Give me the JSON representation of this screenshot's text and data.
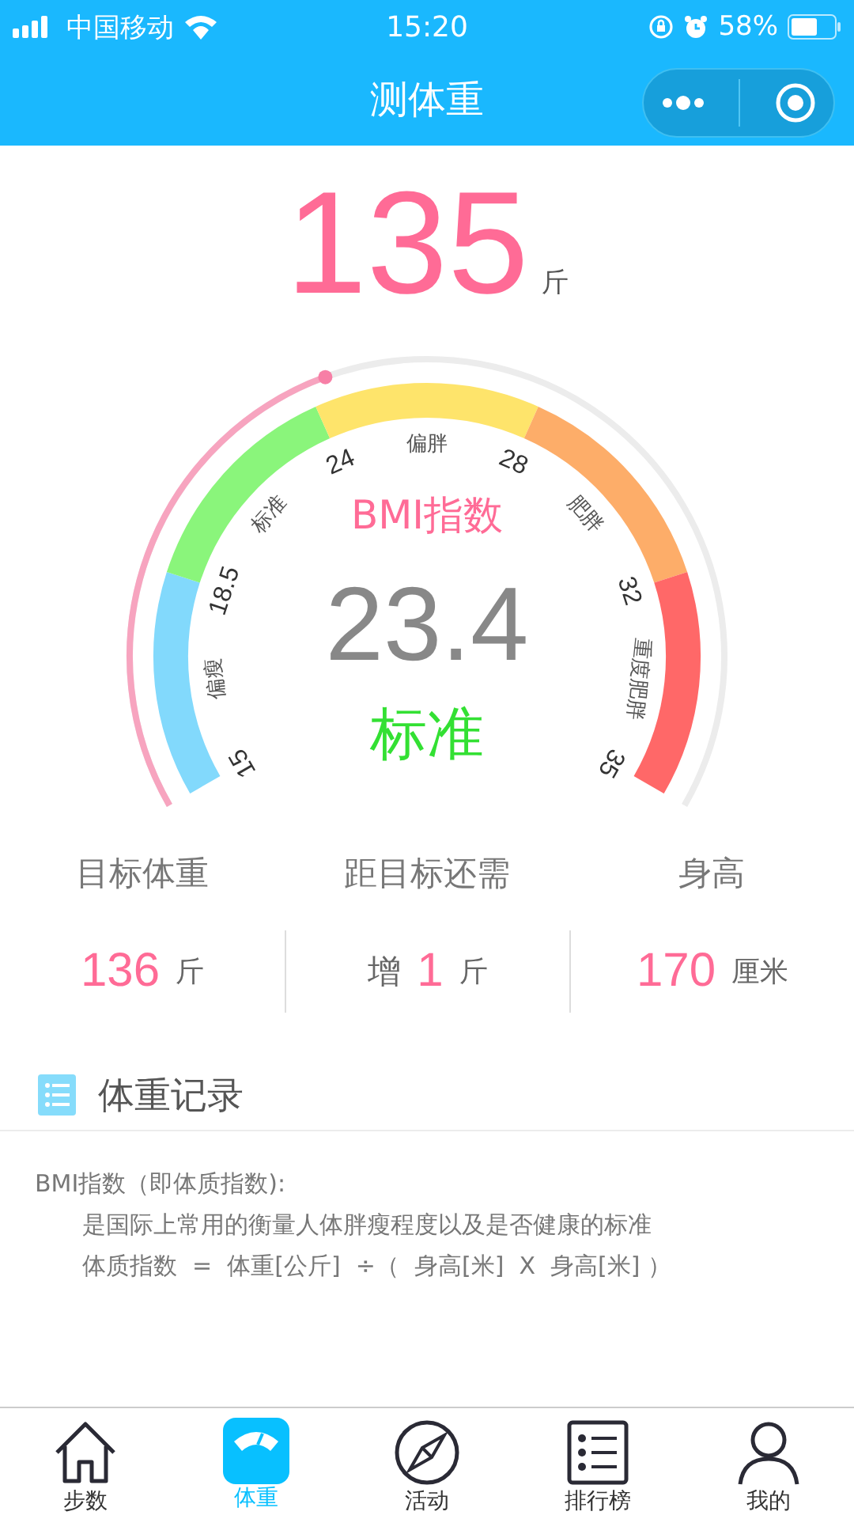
{
  "status_bar": {
    "carrier": "中国移动",
    "time": "15:20",
    "battery": "58%"
  },
  "nav": {
    "title": "测体重"
  },
  "weight": {
    "value": "135",
    "unit": "斤"
  },
  "gauge": {
    "title": "BMI指数",
    "value": "23.4",
    "category": "标准",
    "ticks": [
      "15",
      "18.5",
      "24",
      "28",
      "32",
      "35"
    ],
    "bands": [
      {
        "label": "偏瘦",
        "color": "#82d9fc"
      },
      {
        "label": "标准",
        "color": "#8af57b"
      },
      {
        "label": "偏胖",
        "color": "#fee46b"
      },
      {
        "label": "肥胖",
        "color": "#fdad69"
      },
      {
        "label": "重度肥胖",
        "color": "#ff6868"
      }
    ]
  },
  "stats": [
    {
      "label": "目标体重",
      "value": "136",
      "unit": "斤"
    },
    {
      "label": "距目标还需",
      "prefix": "增",
      "value": "1",
      "unit": "斤"
    },
    {
      "label": "身高",
      "value": "170",
      "unit": "厘米"
    }
  ],
  "records": {
    "title": "体重记录"
  },
  "note": {
    "heading": "BMI指数（即体质指数):",
    "lines": [
      "是国际上常用的衡量人体胖瘦程度以及是否健康的标准",
      "体质指数  =  体重[公斤]  ÷（  身高[米]  X  身高[米] ）"
    ]
  },
  "tabs": [
    {
      "label": "步数",
      "selected": false
    },
    {
      "label": "体重",
      "selected": true
    },
    {
      "label": "活动",
      "selected": false
    },
    {
      "label": "排行榜",
      "selected": false
    },
    {
      "label": "我的",
      "selected": false
    }
  ]
}
